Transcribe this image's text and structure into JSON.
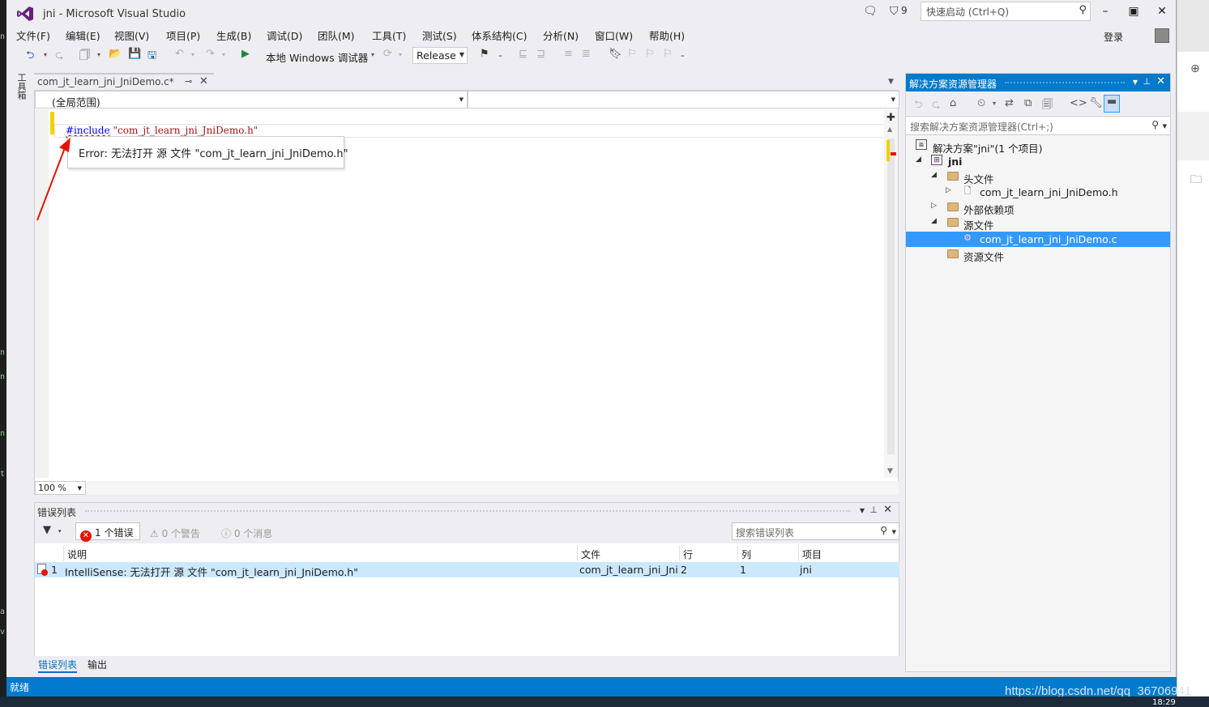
{
  "window": {
    "title": "jni - Microsoft Visual Studio",
    "notification_count": "9",
    "quick_launch_placeholder": "快速启动 (Ctrl+Q)",
    "login": "登录"
  },
  "menu": [
    "文件(F)",
    "编辑(E)",
    "视图(V)",
    "项目(P)",
    "生成(B)",
    "调试(D)",
    "团队(M)",
    "工具(T)",
    "测试(S)",
    "体系结构(C)",
    "分析(N)",
    "窗口(W)",
    "帮助(H)"
  ],
  "toolbar": {
    "debugger_label": "本地 Windows 调试器",
    "configuration": "Release"
  },
  "toolbox_tab": "工具箱",
  "editor": {
    "tab_title": "com_jt_learn_jni_JniDemo.c*",
    "scope": "(全局范围)",
    "code_keyword": "#include",
    "code_string": "\"com_jt_learn_jni_JniDemo.h\"",
    "tooltip": "Error: 无法打开 源 文件 \"com_jt_learn_jni_JniDemo.h\"",
    "zoom": "100 %"
  },
  "error_list": {
    "title": "错误列表",
    "errors": "1 个错误",
    "warnings": "0 个警告",
    "messages": "0 个消息",
    "search_placeholder": "搜索错误列表",
    "columns": [
      "说明",
      "文件",
      "行",
      "列",
      "项目"
    ],
    "rows": [
      {
        "index": "1",
        "description": "IntelliSense: 无法打开 源 文件 \"com_jt_learn_jni_JniDemo.h\"",
        "file": "com_jt_learn_jni_JniI",
        "line": "2",
        "column": "1",
        "project": "jni"
      }
    ],
    "tabs": [
      "错误列表",
      "输出"
    ]
  },
  "solution_explorer": {
    "title": "解决方案资源管理器",
    "search_placeholder": "搜索解决方案资源管理器(Ctrl+;)",
    "tree": {
      "solution": "解决方案\"jni\"(1 个项目)",
      "project": "jni",
      "headers": "头文件",
      "header_file": "com_jt_learn_jni_JniDemo.h",
      "external": "外部依赖项",
      "sources": "源文件",
      "source_file": "com_jt_learn_jni_JniDemo.c",
      "resources": "资源文件"
    }
  },
  "status": "就绪",
  "watermark": "https://blog.csdn.net/qq_36706941",
  "clock": "18:29",
  "colors": {
    "accent": "#007acc",
    "error": "#e51400",
    "selection": "#3399ff",
    "change": "#efd200"
  }
}
